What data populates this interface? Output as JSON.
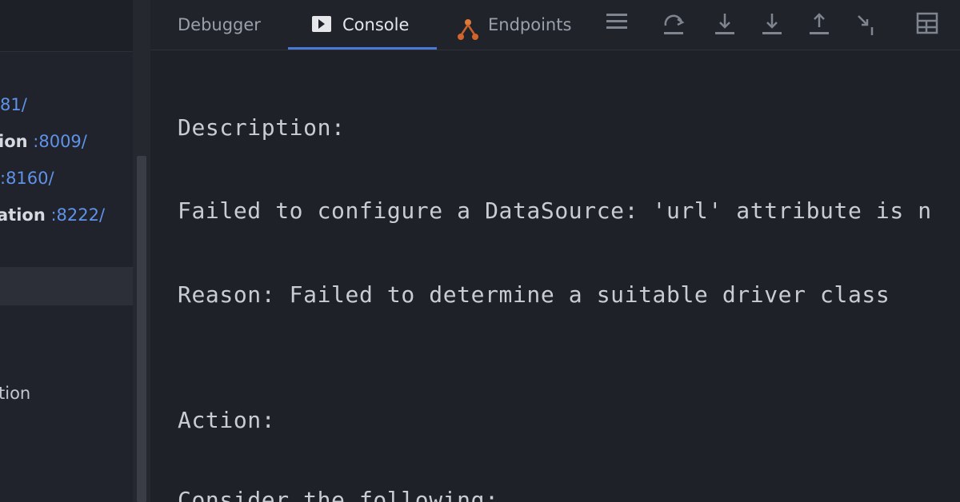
{
  "services": {
    "rows": [
      {
        "name": "",
        "port": "81/"
      },
      {
        "name": "ion",
        "port": ":8009/"
      },
      {
        "name": "",
        "port": ":8160/"
      },
      {
        "name": "ation",
        "port": ":8222/"
      }
    ],
    "partial_item": "tion"
  },
  "toolbar": {
    "tabs": [
      {
        "label": "Debugger"
      },
      {
        "label": "Console"
      },
      {
        "label": "Endpoints"
      }
    ],
    "active_tab": "Console",
    "icons": [
      "menu-icon",
      "step-over-icon",
      "step-into-icon",
      "force-step-into-icon",
      "step-out-icon",
      "run-to-cursor-icon",
      "evaluate-icon"
    ]
  },
  "console": {
    "lines": [
      "Description:",
      "Failed to configure a DataSource: 'url' attribute is n",
      "Reason: Failed to determine a suitable driver class",
      "Action:",
      "Consider the following:"
    ]
  },
  "colors": {
    "background": "#1f2128",
    "text": "#c9ccd2",
    "port": "#5f92e8",
    "active_underline": "#4b7ad6"
  }
}
